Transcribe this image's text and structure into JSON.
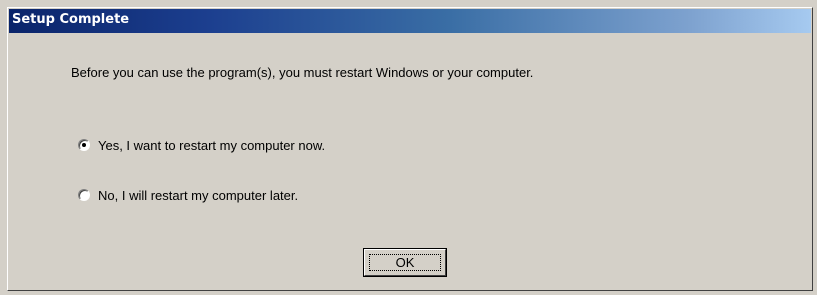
{
  "window": {
    "title": "Setup Complete"
  },
  "dialog": {
    "message": "Before you can use the program(s), you must restart Windows or your computer.",
    "options": [
      {
        "label": "Yes, I want to restart my computer now.",
        "selected": true
      },
      {
        "label": "No, I will restart my computer later.",
        "selected": false
      }
    ],
    "ok_label": "OK"
  }
}
